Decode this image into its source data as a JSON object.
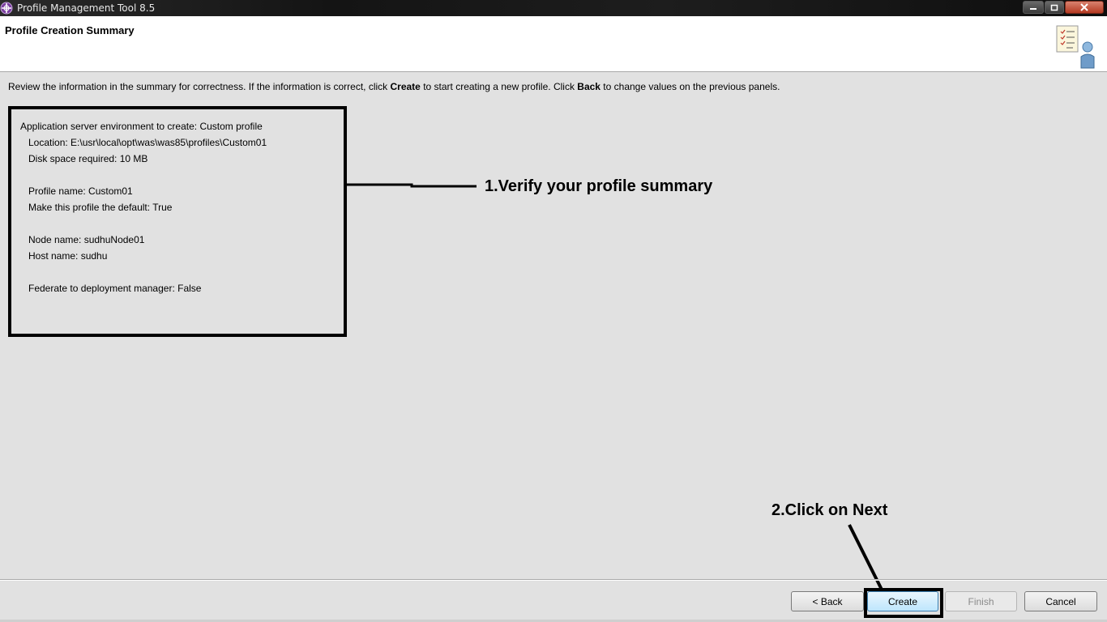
{
  "window": {
    "title": "Profile Management Tool 8.5"
  },
  "header": {
    "title": "Profile Creation Summary"
  },
  "instructions": {
    "part1": "Review the information in the summary for correctness. If the information is correct, click ",
    "create_word": "Create",
    "part2": " to start creating a new profile. Click ",
    "back_word": "Back",
    "part3": " to change values on the previous panels."
  },
  "summary": {
    "environment": "Application server environment to create: Custom profile",
    "location": "Location: E:\\usr\\local\\opt\\was\\was85\\profiles\\Custom01",
    "disk_space": "Disk space required: 10 MB",
    "profile_name": "Profile name: Custom01",
    "default_profile": "Make this profile the default: True",
    "node_name": "Node name: sudhuNode01",
    "host_name": "Host name: sudhu",
    "federate": "Federate to deployment manager: False"
  },
  "annotations": {
    "step1": "1.Verify your profile summary",
    "step2": "2.Click on Next"
  },
  "buttons": {
    "back": "< Back",
    "create": "Create",
    "finish": "Finish",
    "cancel": "Cancel"
  },
  "icons": {
    "app": "app-logo-icon",
    "header": "profile-summary-icon",
    "minimize": "minimize-icon",
    "maximize": "maximize-icon",
    "close": "close-icon"
  }
}
